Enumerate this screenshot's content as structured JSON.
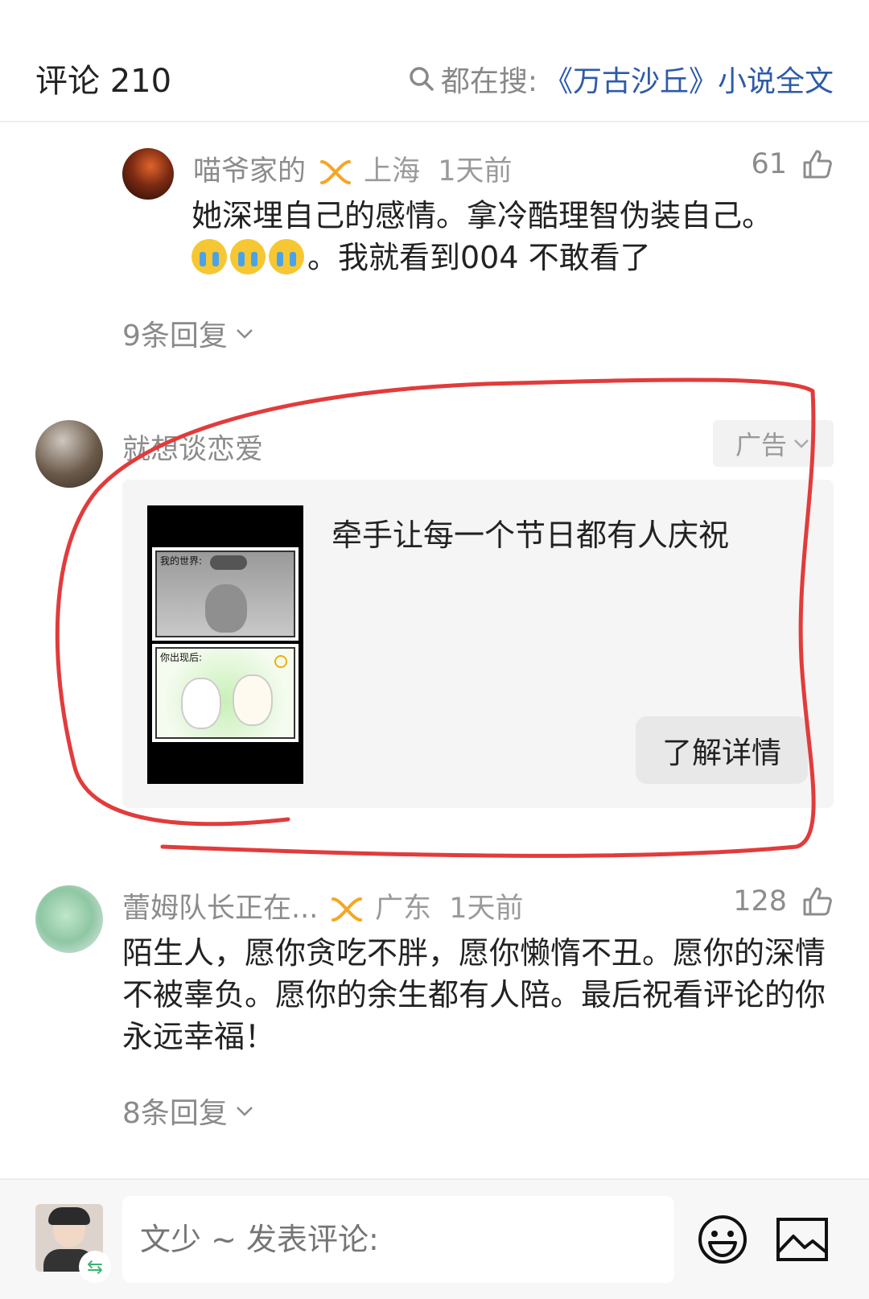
{
  "header": {
    "title": "评论 210",
    "search_prefix": "都在搜:",
    "search_term": "《万古沙丘》小说全文"
  },
  "comments": [
    {
      "username": "喵爷家的",
      "location": "上海",
      "time": "1天前",
      "likes": "61",
      "text_line1": "她深埋自己的感情。拿冷酷理智伪装自己。",
      "text_line2": "。我就看到004 不敢看了",
      "replies": "9条回复"
    },
    {
      "username": "蕾姆队长正在...",
      "location": "广东",
      "time": "1天前",
      "likes": "128",
      "text": "陌生人，愿你贪吃不胖，愿你懒惰不丑。愿你的深情不被辜负。愿你的余生都有人陪。最后祝看评论的你永远幸福！",
      "replies": "8条回复"
    }
  ],
  "ad": {
    "username": "就想谈恋爱",
    "badge": "广告",
    "title": "牵手让每一个节日都有人庆祝",
    "button": "了解详情",
    "panel1_caption": "我的世界:",
    "panel2_caption": "你出现后:"
  },
  "bottom_bar": {
    "input_placeholder": "文少 ~ 发表评论:",
    "icons": [
      "emoji-icon",
      "image-icon"
    ]
  },
  "colors": {
    "link": "#2d5ba8",
    "vip": "#f5a623",
    "annotation": "#e23b3b"
  }
}
